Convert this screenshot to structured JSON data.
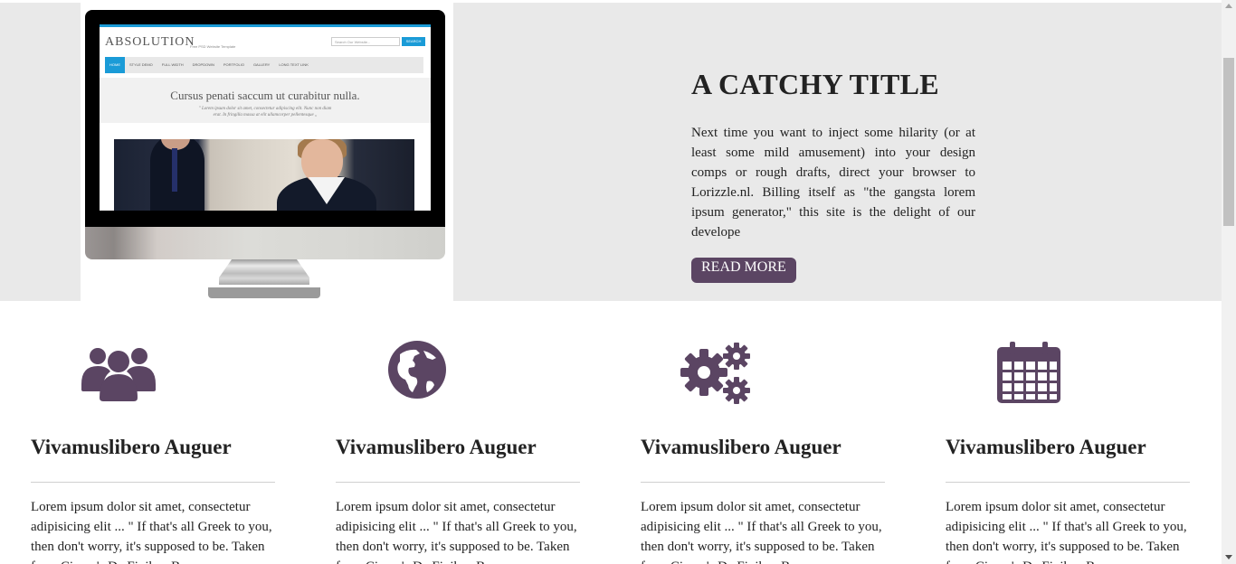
{
  "hero": {
    "title": "A CATCHY TITLE",
    "text": "Next time you want to inject some hilarity (or at least some mild amusement) into your design comps or rough drafts, direct your browser to Lorizzle.nl. Billing itself as \"the gangsta lorem ipsum generator,\" this site is the delight of our develope",
    "button_label": "READ MORE",
    "button_color": "#5b4563",
    "background": "#e9e9e9"
  },
  "mockup": {
    "logo": "ABSOLUTION",
    "logo_sub": "Free PSD Website Template",
    "search_placeholder": "Search Our Website...",
    "search_button": "SEARCH",
    "nav": [
      "HOME",
      "STYLE DEMO",
      "FULL WIDTH",
      "DROPDOWN",
      "PORTFOLIO",
      "GALLERY",
      "LONG TEXT LINK"
    ],
    "band_title": "Cursus penati saccum ut curabitur nulla.",
    "band_sub_1": "\" Lorem ipsum dolor sit amet, consectetur adipiscing elit. Nunc non diam",
    "band_sub_2": "erat. In fringilla massa at elit ullamcorper pellentesque ,,"
  },
  "features": [
    {
      "icon": "users-icon",
      "title": "Vivamuslibero Auguer",
      "text": "Lorem ipsum dolor sit amet, consectetur adipisicing elit ... \" If that's all Greek to you, then don't worry, it's supposed to be. Taken from Cicero's De Finibus Bonorum"
    },
    {
      "icon": "globe-icon",
      "title": "Vivamuslibero Auguer",
      "text": "Lorem ipsum dolor sit amet, consectetur adipisicing elit ... \" If that's all Greek to you, then don't worry, it's supposed to be. Taken from Cicero's De Finibus Bonorum"
    },
    {
      "icon": "gears-icon",
      "title": "Vivamuslibero Auguer",
      "text": "Lorem ipsum dolor sit amet, consectetur adipisicing elit ... \" If that's all Greek to you, then don't worry, it's supposed to be. Taken from Cicero's De Finibus Bonorum"
    },
    {
      "icon": "calendar-icon",
      "title": "Vivamuslibero Auguer",
      "text": "Lorem ipsum dolor sit amet, consectetur adipisicing elit ... \" If that's all Greek to you, then don't worry, it's supposed to be. Taken from Cicero's De Finibus Bonorum"
    }
  ],
  "colors": {
    "icon": "#5b4563",
    "accent_blue": "#1a9bd7"
  }
}
